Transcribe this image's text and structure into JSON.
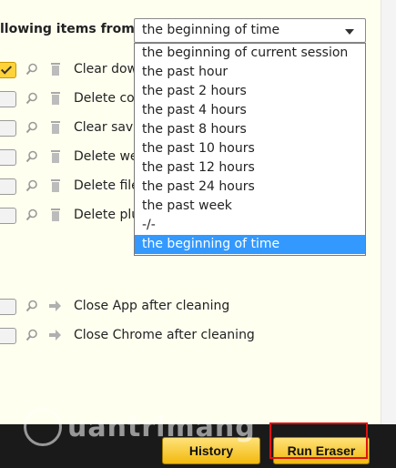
{
  "header": {
    "label": "llowing items from:"
  },
  "select": {
    "value": "the beginning of time",
    "options": [
      "the beginning of current session",
      "the past hour",
      "the past 2 hours",
      "the past 4 hours",
      "the past 8 hours",
      "the past 10 hours",
      "the past 12 hours",
      "the past 24 hours",
      "the past week",
      "-/-",
      "the beginning of time"
    ],
    "selected_index": 10
  },
  "items": [
    {
      "label": "Clear dow",
      "checked": true
    },
    {
      "label": "Delete coo",
      "checked": false
    },
    {
      "label": "Clear save",
      "checked": false
    },
    {
      "label": "Delete we",
      "checked": false
    },
    {
      "label": "Delete file",
      "checked": false
    },
    {
      "label": "Delete plu",
      "checked": false
    }
  ],
  "after_items": [
    {
      "label": "Close App after cleaning",
      "checked": false
    },
    {
      "label": "Close Chrome after cleaning",
      "checked": false
    }
  ],
  "buttons": {
    "history": "History",
    "run": "Run Eraser"
  },
  "watermark": {
    "text": "uantrimang"
  },
  "colors": {
    "accent": "#ffd23a",
    "selection": "#3399ff",
    "highlight_frame": "#e01010"
  }
}
